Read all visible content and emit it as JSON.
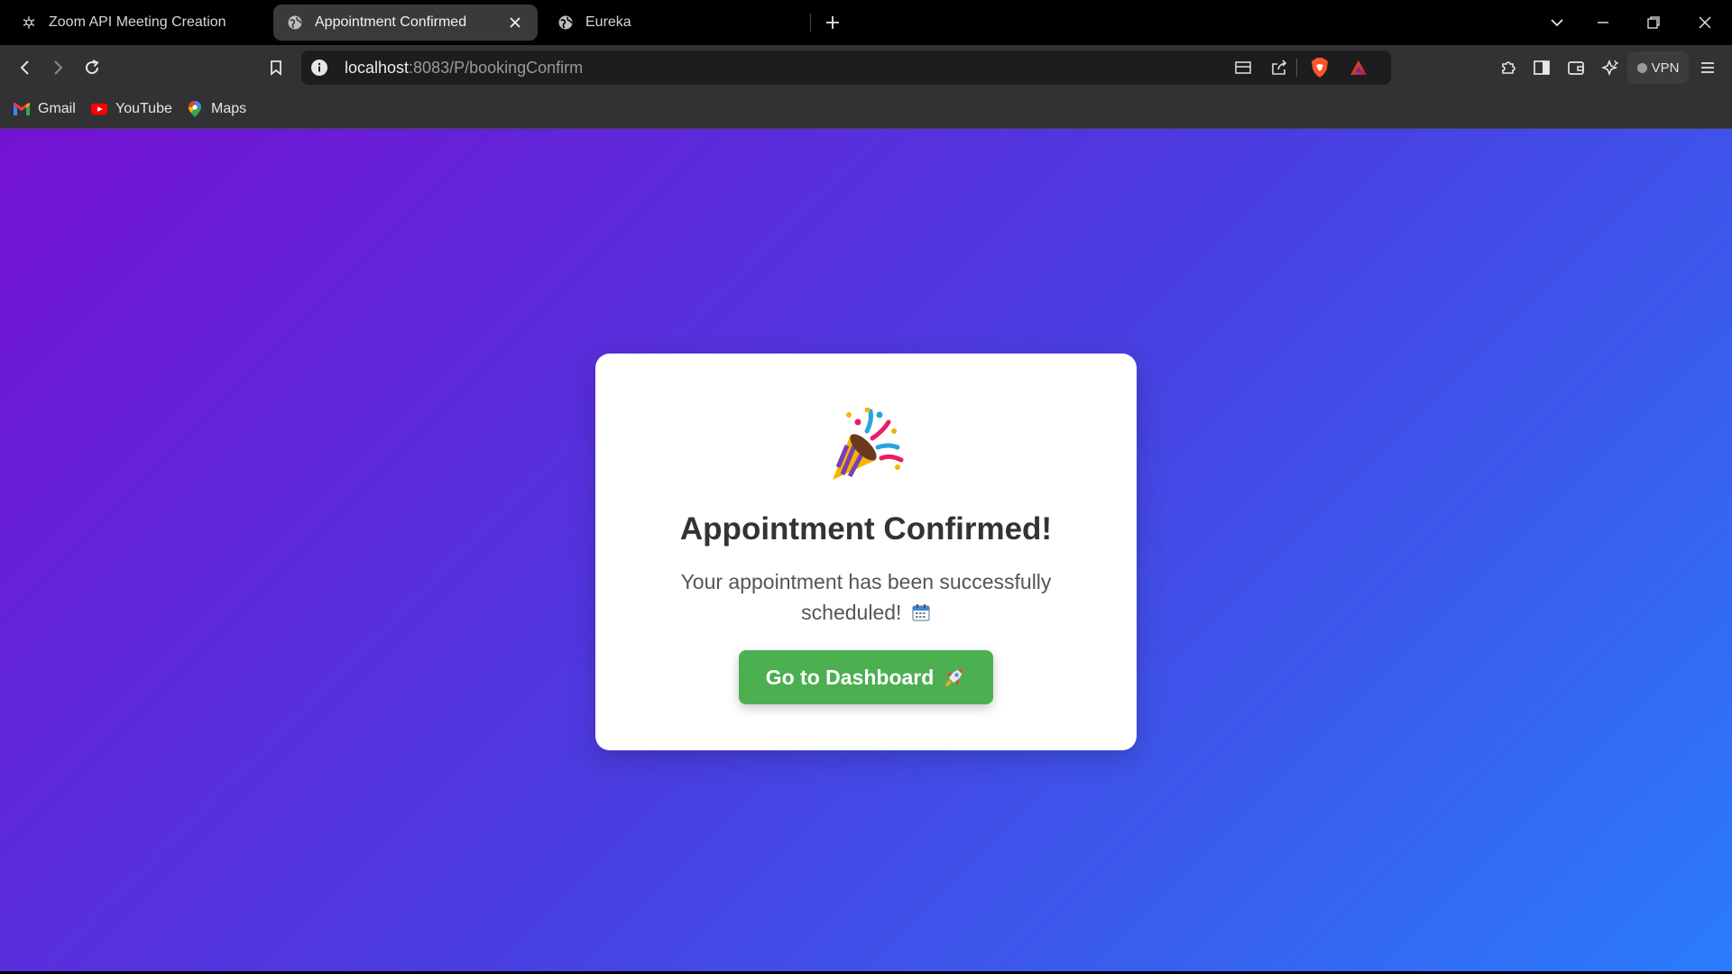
{
  "browser": {
    "tabs": [
      {
        "title": "Zoom API Meeting Creation",
        "icon": "openai-logo-icon",
        "active": false
      },
      {
        "title": "Appointment Confirmed",
        "icon": "globe-icon",
        "active": true
      },
      {
        "title": "Eureka",
        "icon": "globe-icon",
        "active": false
      }
    ],
    "url": {
      "host": "localhost",
      "rest": ":8083/P/bookingConfirm"
    },
    "vpn_label": "VPN",
    "bookmarks": [
      {
        "label": "Gmail",
        "icon": "gmail-icon"
      },
      {
        "label": "YouTube",
        "icon": "youtube-icon"
      },
      {
        "label": "Maps",
        "icon": "maps-icon"
      }
    ]
  },
  "page": {
    "icon": "party-popper-icon",
    "title": "Appointment Confirmed!",
    "message": "Your appointment has been successfully scheduled!",
    "message_icon": "calendar-icon",
    "button_label": "Go to Dashboard",
    "button_icon": "rocket-icon"
  },
  "colors": {
    "gradient_start": "#7512d2",
    "gradient_end": "#2a7cfb",
    "button": "#4caf50",
    "card": "#ffffff",
    "title": "#333333"
  }
}
